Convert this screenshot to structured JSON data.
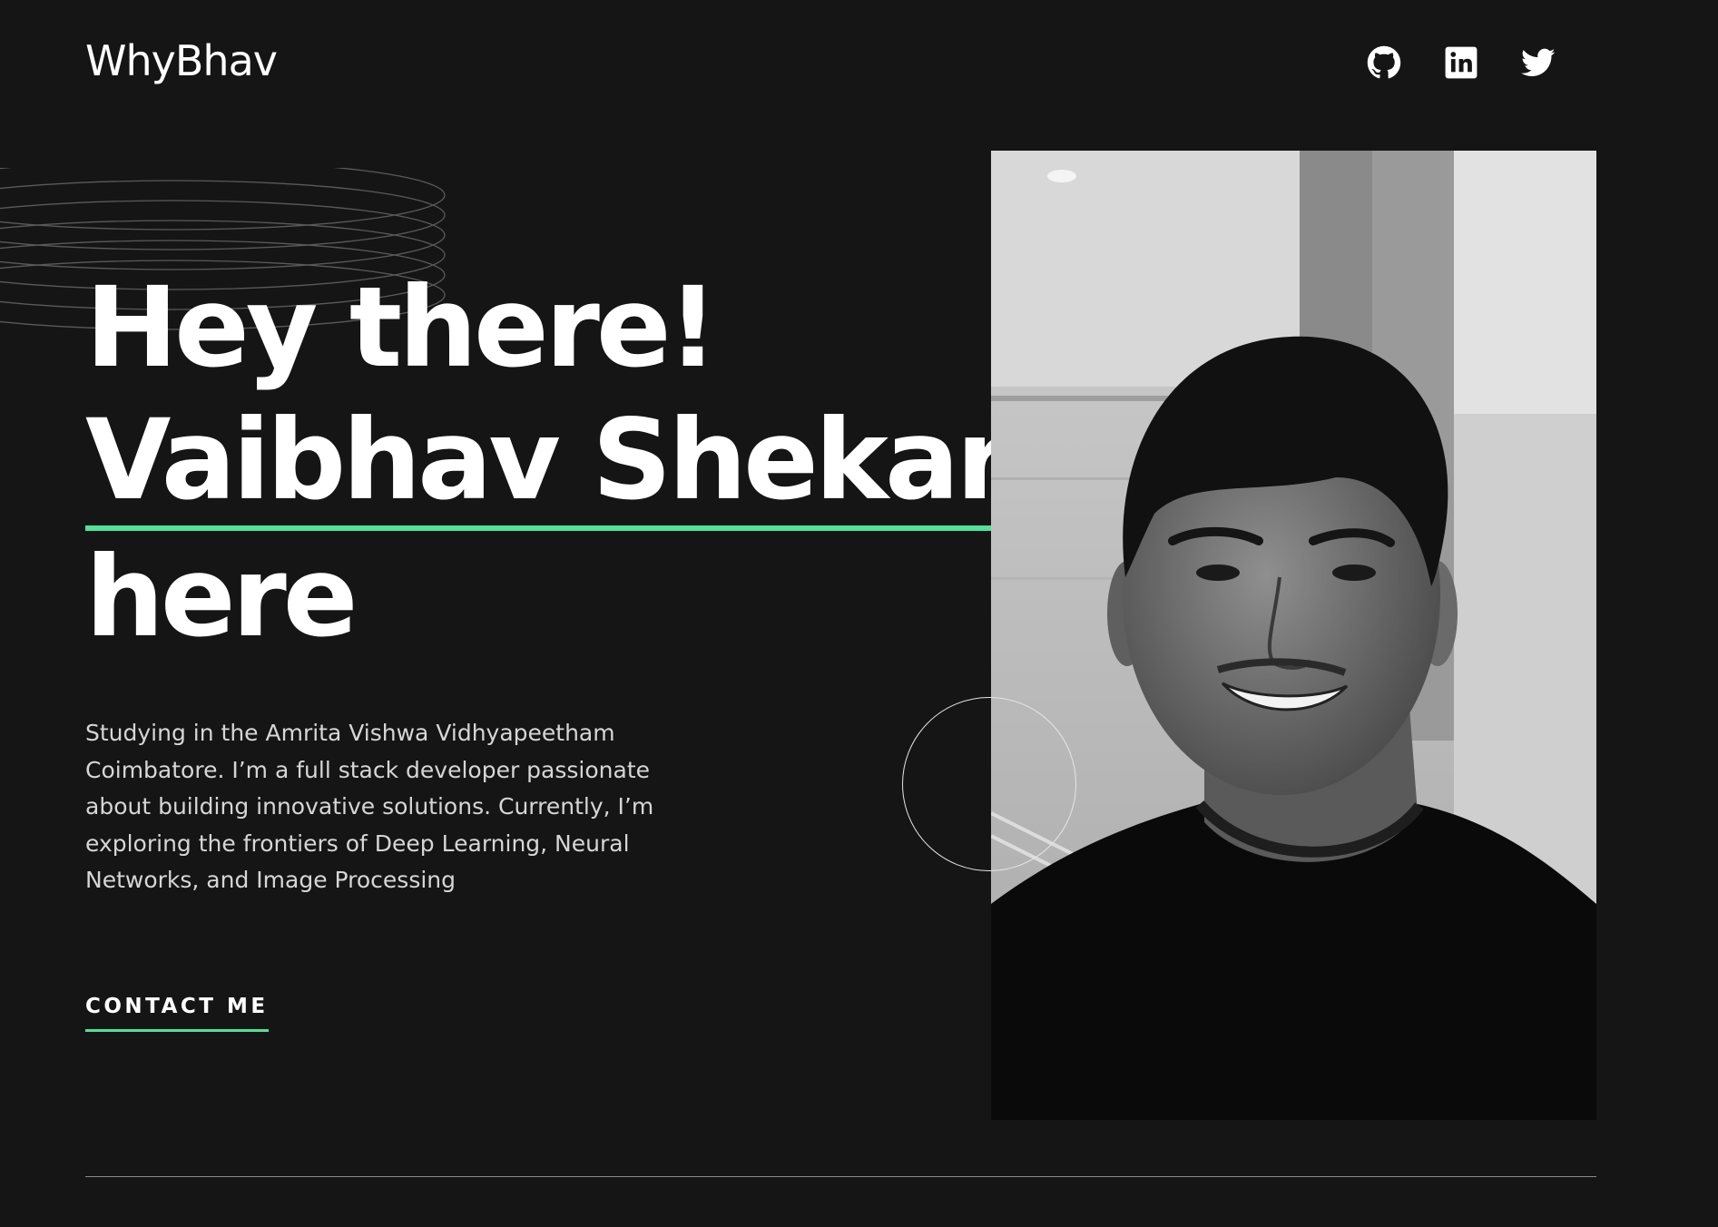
{
  "header": {
    "logo": "WhyBhav",
    "social": [
      {
        "name": "github-icon"
      },
      {
        "name": "linkedin-icon"
      },
      {
        "name": "twitter-icon"
      }
    ]
  },
  "hero": {
    "line1": "Hey there!",
    "line2": "Vaibhav Shekar",
    "line3": "here",
    "bio": "Studying in the Amrita Vishwa Vidhyapeetham Coimbatore. I’m a full stack developer passionate about building innovative solutions. Currently, I’m exploring the frontiers of Deep Learning, Neural Networks, and Image Processing",
    "cta": "CONTACT ME"
  },
  "colors": {
    "background": "#151515",
    "accent": "#4ee39a",
    "text": "#ffffff",
    "muted_text": "#d6d6d6"
  }
}
